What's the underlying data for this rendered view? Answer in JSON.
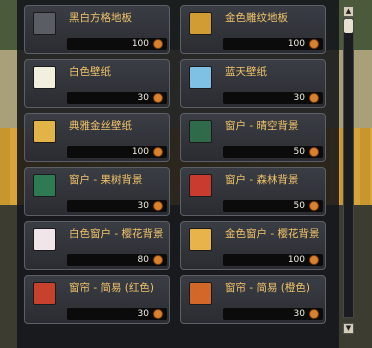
{
  "items": [
    {
      "name": "黑白方格地板",
      "price": "100",
      "thumb_color": "#5a5d63",
      "icon": "checker-floor-icon"
    },
    {
      "name": "金色雕纹地板",
      "price": "100",
      "thumb_color": "#d19c34",
      "icon": "gold-floor-icon"
    },
    {
      "name": "白色壁纸",
      "price": "30",
      "thumb_color": "#f2efdf",
      "icon": "white-wallpaper-icon"
    },
    {
      "name": "蓝天壁纸",
      "price": "30",
      "thumb_color": "#7fc1e4",
      "icon": "sky-wallpaper-icon"
    },
    {
      "name": "典雅金丝壁纸",
      "price": "100",
      "thumb_color": "#e2b447",
      "icon": "gold-wallpaper-icon"
    },
    {
      "name": "窗户 - 晴空背景",
      "price": "50",
      "thumb_color": "#2f6a4a",
      "icon": "window-sky-icon"
    },
    {
      "name": "窗户 - 果树背景",
      "price": "30",
      "thumb_color": "#2e7a53",
      "icon": "window-fruit-tree-icon"
    },
    {
      "name": "窗户 - 森林背景",
      "price": "50",
      "thumb_color": "#c93a2f",
      "icon": "window-forest-icon"
    },
    {
      "name": "白色窗户 - 樱花背景",
      "price": "80",
      "thumb_color": "#f0e6e9",
      "icon": "white-window-sakura-icon"
    },
    {
      "name": "金色窗户 - 樱花背景",
      "price": "100",
      "thumb_color": "#e7b34a",
      "icon": "gold-window-sakura-icon"
    },
    {
      "name": "窗帘 - 简易 (红色)",
      "price": "30",
      "thumb_color": "#c8412d",
      "icon": "red-curtain-icon"
    },
    {
      "name": "窗帘 - 简易 (橙色)",
      "price": "30",
      "thumb_color": "#d2672a",
      "icon": "orange-curtain-icon"
    }
  ],
  "scrollbar": {
    "up": "▲",
    "down": "▼"
  }
}
